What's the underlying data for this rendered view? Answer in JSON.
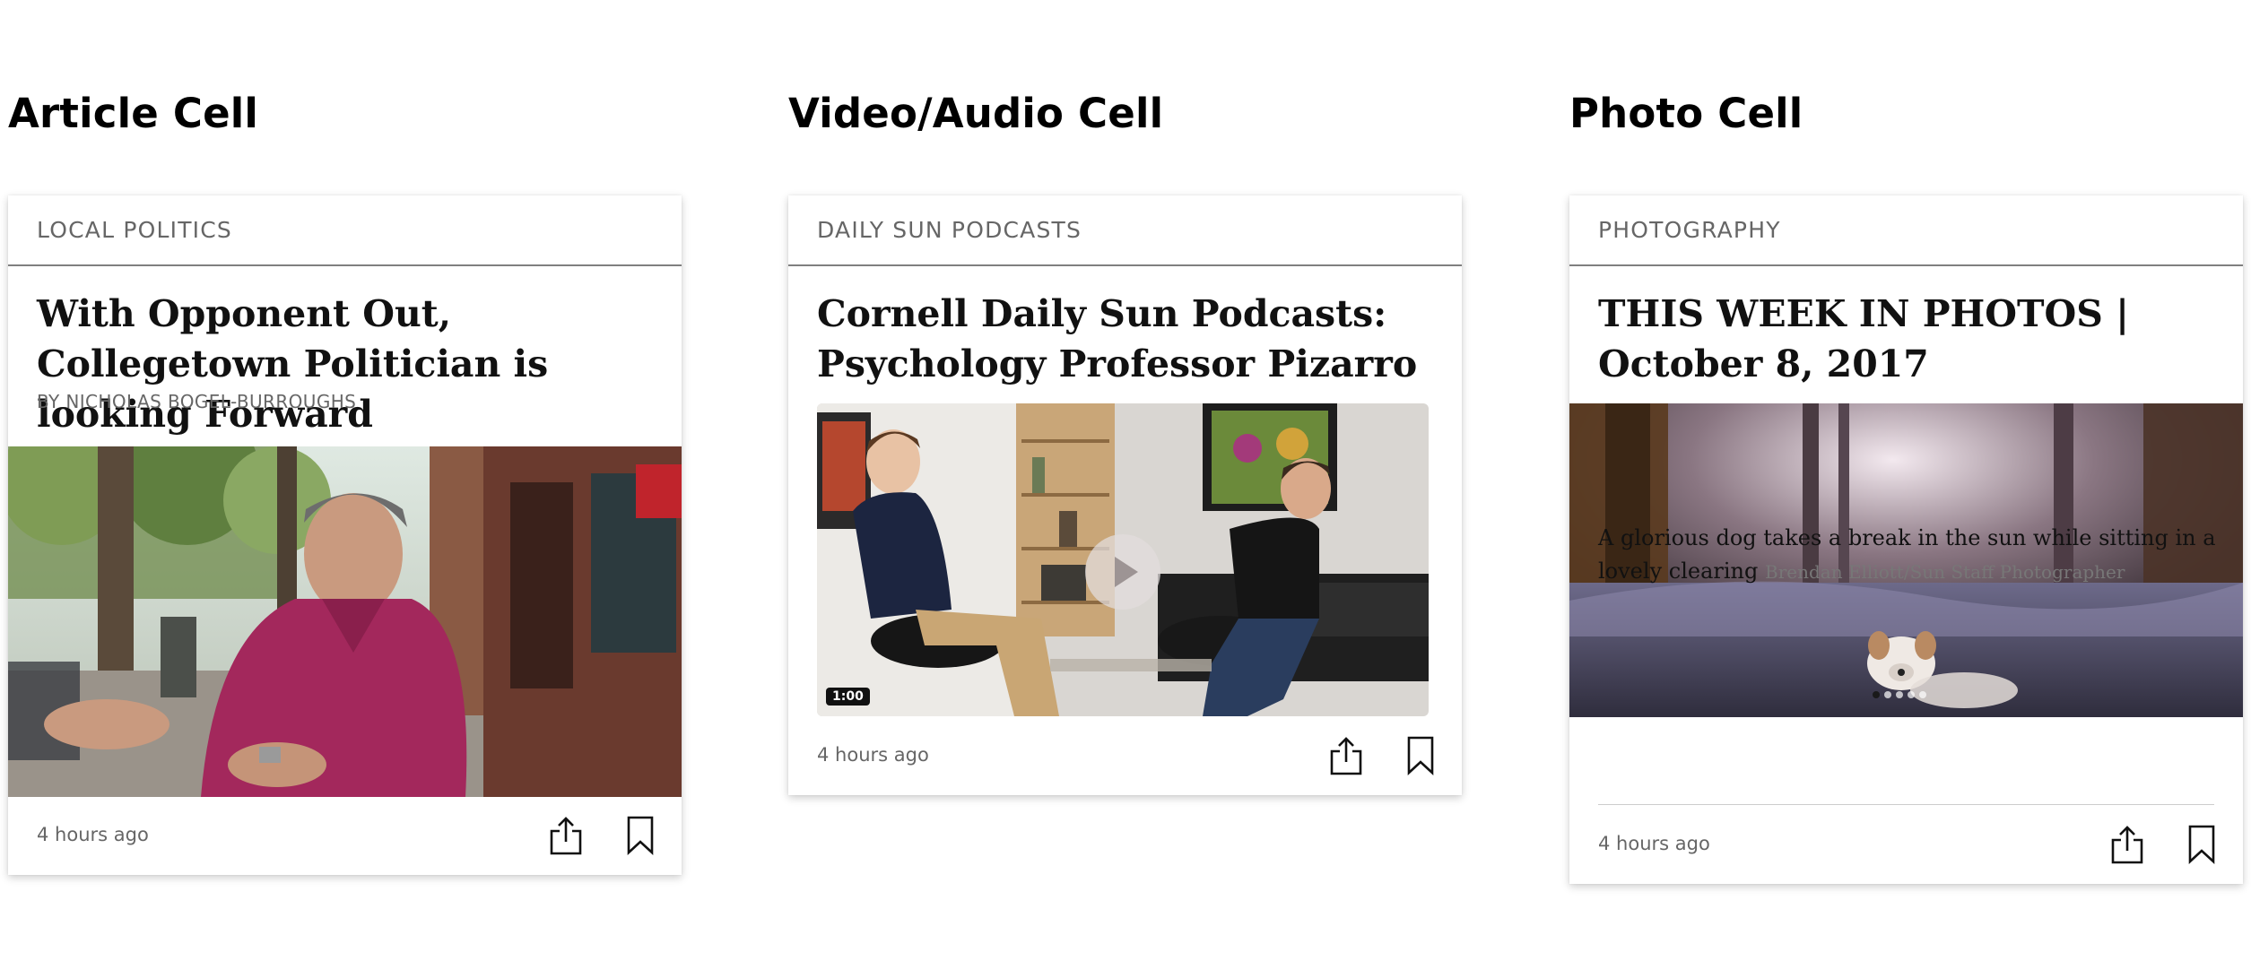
{
  "sections": {
    "article_title": "Article Cell",
    "video_title": "Video/Audio Cell",
    "photo_title": "Photo Cell"
  },
  "article": {
    "section": "LOCAL POLITICS",
    "headline": "With Opponent Out, Collegetown Politician is looking Forward",
    "byline": "BY NICHOLAS BOGEL-BURROUGHS",
    "timestamp": "4 hours ago",
    "share_icon": "share-icon",
    "bookmark_icon": "bookmark-icon"
  },
  "video": {
    "section": "DAILY SUN PODCASTS",
    "headline": "Cornell Daily Sun Podcasts: Psychology Professor Pizarro",
    "duration": "1:00",
    "timestamp": "4 hours ago",
    "play_icon": "play-icon"
  },
  "photo": {
    "section": "PHOTOGRAPHY",
    "headline": "THIS WEEK IN PHOTOS | October 8, 2017",
    "caption": "A glorious dog takes a break in the sun while sitting in a lovely clearing",
    "credit": "Brendan Elliott/Sun Staff Photographer",
    "timestamp": "4 hours ago",
    "slide_count": 5,
    "active_slide": 1
  },
  "colors": {
    "label_gray": "#666666",
    "divider_gray": "#7f7f7f",
    "text_dark": "#111111"
  }
}
